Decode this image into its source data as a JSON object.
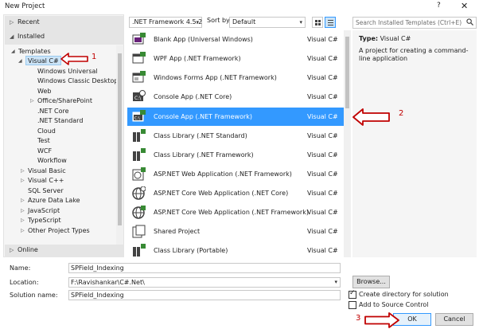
{
  "window": {
    "title": "New Project",
    "help": "?",
    "close": "✕"
  },
  "left": {
    "recent": "Recent",
    "installed": "Installed",
    "online": "Online",
    "tree": [
      {
        "label": "Templates",
        "arrow": "◢"
      },
      {
        "label": "Visual C#",
        "arrow": "◢"
      },
      {
        "label": "Windows Universal",
        "arrow": ""
      },
      {
        "label": "Windows Classic Desktop",
        "arrow": ""
      },
      {
        "label": "Web",
        "arrow": ""
      },
      {
        "label": "Office/SharePoint",
        "arrow": "▷"
      },
      {
        "label": ".NET Core",
        "arrow": ""
      },
      {
        "label": ".NET Standard",
        "arrow": ""
      },
      {
        "label": "Cloud",
        "arrow": ""
      },
      {
        "label": "Test",
        "arrow": ""
      },
      {
        "label": "WCF",
        "arrow": ""
      },
      {
        "label": "Workflow",
        "arrow": ""
      },
      {
        "label": "Visual Basic",
        "arrow": "▷"
      },
      {
        "label": "Visual C++",
        "arrow": "▷"
      },
      {
        "label": "SQL Server",
        "arrow": ""
      },
      {
        "label": "Azure Data Lake",
        "arrow": "▷"
      },
      {
        "label": "JavaScript",
        "arrow": "▷"
      },
      {
        "label": "TypeScript",
        "arrow": "▷"
      },
      {
        "label": "Other Project Types",
        "arrow": "▷"
      }
    ]
  },
  "toolbar": {
    "framework": ".NET Framework 4.5.2",
    "sort_label": "Sort by:",
    "sort_value": "Default"
  },
  "templates": [
    {
      "name": "Blank App (Universal Windows)",
      "lang": "Visual C#"
    },
    {
      "name": "WPF App (.NET Framework)",
      "lang": "Visual C#"
    },
    {
      "name": "Windows Forms App (.NET Framework)",
      "lang": "Visual C#"
    },
    {
      "name": "Console App (.NET Core)",
      "lang": "Visual C#"
    },
    {
      "name": "Console App (.NET Framework)",
      "lang": "Visual C#"
    },
    {
      "name": "Class Library (.NET Standard)",
      "lang": "Visual C#"
    },
    {
      "name": "Class Library (.NET Framework)",
      "lang": "Visual C#"
    },
    {
      "name": "ASP.NET Web Application (.NET Framework)",
      "lang": "Visual C#"
    },
    {
      "name": "ASP.NET Core Web Application (.NET Core)",
      "lang": "Visual C#"
    },
    {
      "name": "ASP.NET Core Web Application (.NET Framework)",
      "lang": "Visual C#"
    },
    {
      "name": "Shared Project",
      "lang": "Visual C#"
    },
    {
      "name": "Class Library (Portable)",
      "lang": "Visual C#"
    }
  ],
  "search": {
    "placeholder": "Search Installed Templates (Ctrl+E)"
  },
  "details": {
    "type_label": "Type:",
    "type_value": "Visual C#",
    "description": "A project for creating a command-line application"
  },
  "form": {
    "name_label": "Name:",
    "name_value": "SPField_Indexing",
    "location_label": "Location:",
    "location_value": "F:\\Ravishankar\\C#.Net\\",
    "solution_label": "Solution name:",
    "solution_value": "SPField_Indexing",
    "browse": "Browse...",
    "create_dir": "Create directory for solution",
    "source_control": "Add to Source Control",
    "ok": "OK",
    "cancel": "Cancel"
  },
  "annotations": {
    "one": "1",
    "two": "2",
    "three": "3"
  },
  "colors": {
    "selection": "#3399ff",
    "annotation": "#c00000"
  }
}
